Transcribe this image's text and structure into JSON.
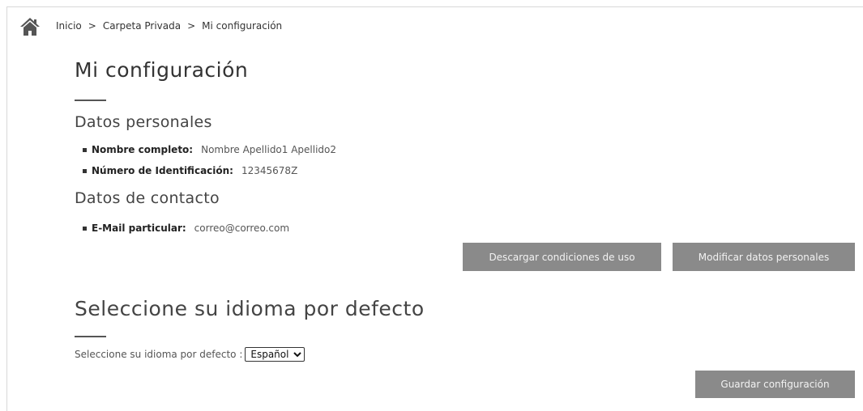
{
  "icons": {
    "home": "home-icon"
  },
  "breadcrumb": {
    "items": [
      "Inicio",
      "Carpeta Privada",
      "Mi configuración"
    ],
    "separator": ">"
  },
  "page_title": "Mi configuración",
  "personal": {
    "title": "Datos personales",
    "fields": [
      {
        "label": "Nombre completo:",
        "value": "Nombre Apellido1 Apellido2"
      },
      {
        "label": "Número de Identificación:",
        "value": "12345678Z"
      }
    ]
  },
  "contact": {
    "title": "Datos de contacto",
    "fields": [
      {
        "label": "E-Mail particular:",
        "value": "correo@correo.com"
      }
    ]
  },
  "buttons": {
    "download": "Descargar condiciones de uso",
    "modify": "Modificar datos personales",
    "save": "Guardar configuración"
  },
  "language": {
    "title": "Seleccione su idioma por defecto",
    "label": "Seleccione su idioma por defecto :",
    "selected": "Español"
  },
  "colors": {
    "button_bg": "#8a8a8a",
    "button_text": "#f2f2f2",
    "text": "#333333"
  }
}
